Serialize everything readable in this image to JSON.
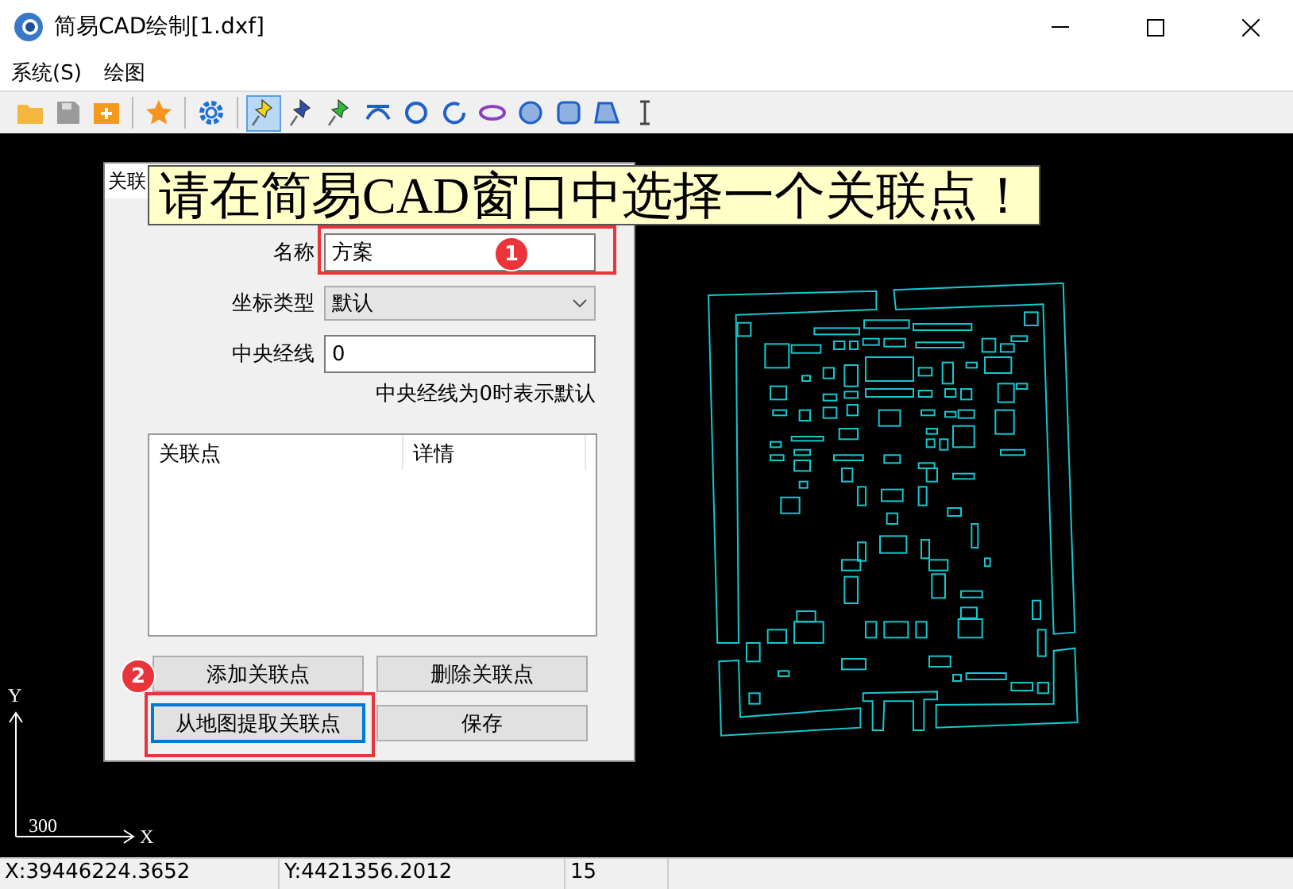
{
  "window": {
    "title": "简易CAD绘制[1.dxf]"
  },
  "menu": [
    "系统(S)",
    "绘图"
  ],
  "toolbar": [
    {
      "kind": "folder",
      "selected": false
    },
    {
      "kind": "disk",
      "selected": false
    },
    {
      "kind": "add-folder",
      "selected": false
    },
    {
      "kind": "separator"
    },
    {
      "kind": "star",
      "selected": false
    },
    {
      "kind": "separator"
    },
    {
      "kind": "gear",
      "selected": false
    },
    {
      "kind": "separator"
    },
    {
      "kind": "pin-yellow",
      "selected": true
    },
    {
      "kind": "pin-blue",
      "selected": false
    },
    {
      "kind": "pin-green",
      "selected": false
    },
    {
      "kind": "arc",
      "selected": false
    },
    {
      "kind": "circle",
      "selected": false
    },
    {
      "kind": "open-circle",
      "selected": false
    },
    {
      "kind": "ellipse",
      "selected": false
    },
    {
      "kind": "filled-circle",
      "selected": false
    },
    {
      "kind": "filled-square",
      "selected": false
    },
    {
      "kind": "filled-quad",
      "selected": false
    },
    {
      "kind": "text-cursor",
      "selected": false
    }
  ],
  "banner": "请在简易CAD窗口中选择一个关联点！",
  "dialog": {
    "tab": "关联",
    "fields": [
      {
        "kind": "text",
        "label": "名称",
        "value": "方案"
      },
      {
        "kind": "select",
        "label": "坐标类型",
        "value": "默认"
      },
      {
        "kind": "text",
        "label": "中央经线",
        "value": "0"
      }
    ],
    "hint": "中央经线为0时表示默认",
    "table": {
      "columns": [
        "关联点",
        "详情"
      ]
    },
    "buttons": [
      {
        "label": "添加关联点",
        "focused": false
      },
      {
        "label": "删除关联点",
        "focused": false
      },
      {
        "label": "从地图提取关联点",
        "focused": true
      },
      {
        "label": "保存",
        "focused": false
      }
    ]
  },
  "markers": [
    {
      "label": "1"
    },
    {
      "label": "2"
    }
  ],
  "axis": {
    "y": "Y",
    "x": "X",
    "scale": "300"
  },
  "status_bar": [
    "X:39446224.3652",
    "Y:4421356.2012",
    "15"
  ]
}
